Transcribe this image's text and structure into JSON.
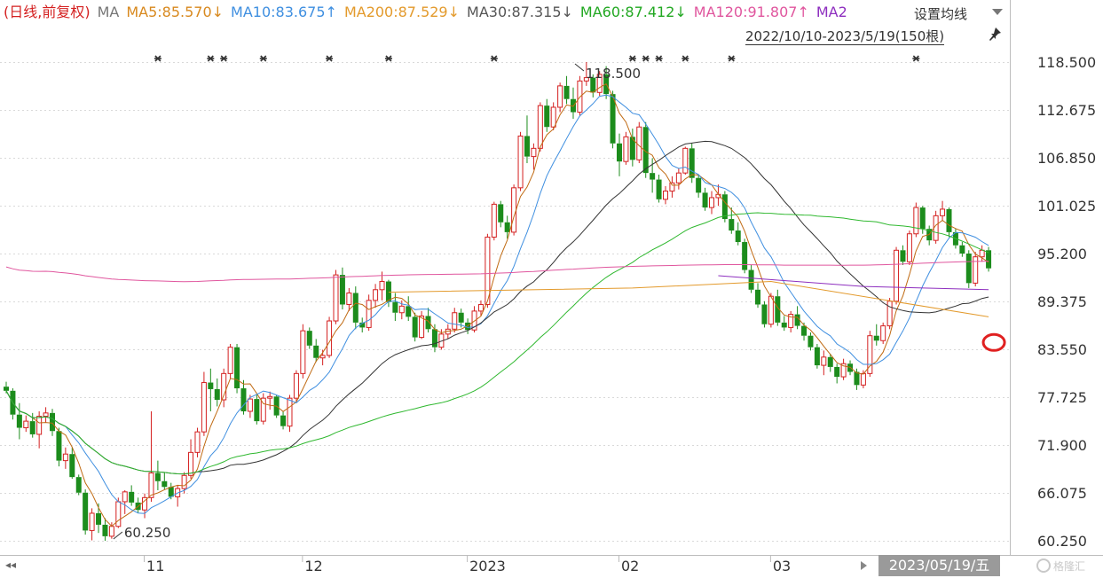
{
  "legend": {
    "period": "(日线,前复权)",
    "ma_label": "MA",
    "ma5": "MA5:85.570↓",
    "ma10": "MA10:83.675↑",
    "ma200": "MA200:87.529↓",
    "ma30": "MA30:87.315↓",
    "ma60": "MA60:87.412↓",
    "ma120": "MA120:91.807↑",
    "ma_more": "MA2"
  },
  "settings_label": "设置均线",
  "date_range": "2022/10/10-2023/5/19(150根)",
  "selected_date": "2023/05/19/五",
  "watermark": "格隆汇",
  "colors": {
    "up": "#d42020",
    "down": "#1c8c1c",
    "ma5": "#c06a12",
    "ma10": "#3f8fe0",
    "ma30": "#333333",
    "ma60": "#2fb82f",
    "ma120": "#e0569e",
    "ma200": "#e39a2c",
    "ma_extra": "#8e2fbf",
    "ma5_text": "#d8891f",
    "ma10_text": "#3f8fe0",
    "ma200_text": "#e39a2c",
    "ma30_text": "#555555",
    "ma60_text": "#22a822",
    "ma120_text": "#e0569e",
    "ma_more_text": "#8e2fbf",
    "highlight": "#e02020"
  },
  "chart_data": {
    "type": "candlestick",
    "y_ticks": [
      "118.500",
      "112.675",
      "106.850",
      "101.025",
      "95.200",
      "89.375",
      "83.550",
      "77.725",
      "71.900",
      "66.075",
      "60.250"
    ],
    "ylim": [
      60.25,
      118.5
    ],
    "x_labels": [
      {
        "label": "11",
        "index": 21
      },
      {
        "label": "12",
        "index": 45
      },
      {
        "label": "2023",
        "index": 70
      },
      {
        "label": "02",
        "index": 93
      },
      {
        "label": "03",
        "index": 116
      },
      {
        "label": "04",
        "index": 139
      }
    ],
    "annotations": [
      {
        "text": "118.500",
        "index": 86,
        "value": 118.5
      },
      {
        "text": "60.250",
        "index": 16,
        "value": 60.25
      }
    ],
    "marker_indices": [
      23,
      31,
      33,
      39,
      49,
      58,
      74,
      95,
      97,
      99,
      103,
      110,
      138,
      167,
      174,
      176,
      178
    ],
    "ohlc": [
      [
        79.0,
        79.6,
        78.2,
        78.5
      ],
      [
        78.5,
        78.8,
        75.0,
        75.6
      ],
      [
        75.6,
        77.0,
        72.6,
        74.0
      ],
      [
        74.0,
        75.5,
        73.5,
        74.8
      ],
      [
        74.8,
        75.8,
        72.8,
        73.2
      ],
      [
        73.2,
        76.0,
        71.5,
        75.4
      ],
      [
        75.4,
        76.5,
        74.6,
        75.8
      ],
      [
        75.8,
        76.3,
        73.0,
        73.6
      ],
      [
        73.6,
        74.0,
        69.3,
        70.0
      ],
      [
        70.0,
        71.6,
        69.0,
        70.8
      ],
      [
        70.8,
        71.6,
        67.8,
        68.0
      ],
      [
        68.0,
        68.3,
        65.8,
        66.1
      ],
      [
        66.1,
        66.5,
        61.0,
        61.5
      ],
      [
        61.5,
        64.2,
        60.3,
        63.6
      ],
      [
        63.6,
        64.8,
        61.2,
        62.2
      ],
      [
        62.2,
        63.0,
        60.25,
        60.8
      ],
      [
        60.8,
        62.5,
        60.5,
        62.0
      ],
      [
        62.0,
        65.5,
        61.8,
        65.0
      ],
      [
        65.0,
        66.4,
        63.5,
        66.2
      ],
      [
        66.2,
        67.0,
        64.5,
        64.9
      ],
      [
        64.9,
        65.5,
        63.6,
        64.0
      ],
      [
        64.0,
        66.0,
        63.0,
        65.5
      ],
      [
        65.5,
        76.0,
        65.0,
        68.5
      ],
      [
        68.5,
        70.0,
        66.4,
        67.5
      ],
      [
        67.5,
        68.5,
        66.5,
        66.8
      ],
      [
        66.8,
        67.3,
        65.3,
        65.6
      ],
      [
        65.6,
        67.0,
        64.4,
        66.6
      ],
      [
        66.6,
        68.6,
        66.0,
        68.2
      ],
      [
        68.2,
        72.6,
        67.8,
        71.0
      ],
      [
        71.0,
        74.0,
        70.4,
        73.5
      ],
      [
        73.5,
        80.8,
        73.0,
        79.5
      ],
      [
        79.5,
        81.2,
        76.0,
        78.7
      ],
      [
        78.7,
        80.0,
        76.6,
        77.4
      ],
      [
        77.4,
        81.2,
        76.5,
        80.6
      ],
      [
        80.6,
        84.2,
        80.0,
        83.8
      ],
      [
        83.8,
        84.2,
        78.2,
        78.8
      ],
      [
        78.8,
        79.8,
        75.6,
        76.0
      ],
      [
        76.0,
        78.0,
        75.2,
        77.5
      ],
      [
        77.5,
        78.0,
        74.4,
        74.8
      ],
      [
        74.8,
        78.2,
        74.4,
        77.6
      ],
      [
        77.6,
        78.4,
        76.2,
        77.8
      ],
      [
        77.8,
        78.0,
        75.2,
        75.5
      ],
      [
        75.5,
        76.0,
        73.8,
        74.2
      ],
      [
        74.2,
        78.0,
        73.5,
        77.6
      ],
      [
        77.6,
        81.0,
        77.0,
        80.6
      ],
      [
        80.6,
        86.6,
        80.0,
        85.8
      ],
      [
        85.8,
        86.2,
        83.6,
        84.0
      ],
      [
        84.0,
        84.8,
        82.0,
        82.5
      ],
      [
        82.5,
        83.5,
        81.6,
        82.8
      ],
      [
        82.8,
        87.5,
        82.5,
        87.0
      ],
      [
        87.0,
        93.2,
        86.6,
        92.6
      ],
      [
        92.6,
        93.5,
        88.4,
        89.0
      ],
      [
        89.0,
        91.0,
        88.2,
        90.4
      ],
      [
        90.4,
        91.2,
        86.0,
        86.8
      ],
      [
        86.8,
        87.4,
        85.6,
        86.2
      ],
      [
        86.2,
        90.2,
        85.8,
        89.5
      ],
      [
        89.5,
        91.5,
        88.6,
        90.8
      ],
      [
        90.8,
        93.0,
        89.5,
        91.8
      ],
      [
        91.8,
        92.0,
        88.7,
        89.3
      ],
      [
        89.3,
        90.4,
        87.0,
        88.0
      ],
      [
        88.0,
        89.5,
        87.2,
        88.8
      ],
      [
        88.8,
        90.0,
        87.0,
        87.5
      ],
      [
        87.5,
        88.0,
        84.5,
        85.0
      ],
      [
        85.0,
        88.2,
        84.8,
        87.6
      ],
      [
        87.6,
        88.6,
        85.6,
        86.0
      ],
      [
        86.0,
        86.6,
        83.2,
        83.8
      ],
      [
        83.8,
        86.0,
        83.5,
        85.4
      ],
      [
        85.4,
        86.6,
        84.8,
        86.0
      ],
      [
        86.0,
        88.6,
        85.6,
        88.0
      ],
      [
        88.0,
        88.5,
        86.2,
        86.8
      ],
      [
        86.8,
        87.3,
        85.4,
        85.9
      ],
      [
        85.9,
        88.8,
        85.6,
        88.2
      ],
      [
        88.2,
        89.5,
        87.6,
        89.0
      ],
      [
        89.0,
        97.6,
        88.6,
        97.2
      ],
      [
        97.2,
        101.5,
        96.8,
        101.2
      ],
      [
        101.2,
        101.6,
        98.4,
        99.0
      ],
      [
        99.0,
        99.8,
        97.0,
        97.8
      ],
      [
        97.8,
        103.6,
        97.4,
        103.2
      ],
      [
        103.2,
        110.0,
        102.8,
        109.5
      ],
      [
        109.5,
        112.0,
        106.2,
        107.0
      ],
      [
        107.0,
        108.6,
        105.4,
        108.0
      ],
      [
        108.0,
        113.6,
        107.6,
        113.2
      ],
      [
        113.2,
        114.0,
        110.0,
        110.6
      ],
      [
        110.6,
        113.6,
        110.2,
        113.0
      ],
      [
        113.0,
        116.0,
        112.4,
        115.6
      ],
      [
        115.6,
        116.8,
        113.4,
        114.0
      ],
      [
        114.0,
        115.4,
        111.6,
        112.4
      ],
      [
        112.4,
        116.8,
        112.0,
        116.2
      ],
      [
        116.2,
        118.5,
        115.6,
        116.6
      ],
      [
        116.6,
        117.0,
        114.2,
        114.8
      ],
      [
        114.8,
        117.4,
        114.4,
        117.0
      ],
      [
        117.0,
        118.0,
        114.0,
        114.6
      ],
      [
        114.6,
        115.0,
        108.0,
        108.6
      ],
      [
        108.6,
        109.8,
        104.6,
        106.4
      ],
      [
        106.4,
        110.0,
        106.0,
        109.4
      ],
      [
        109.4,
        110.4,
        105.8,
        106.6
      ],
      [
        106.6,
        111.2,
        106.2,
        110.6
      ],
      [
        110.6,
        111.2,
        104.4,
        105.0
      ],
      [
        105.0,
        106.8,
        102.6,
        104.2
      ],
      [
        104.2,
        104.8,
        101.4,
        101.8
      ],
      [
        101.8,
        103.4,
        101.2,
        102.8
      ],
      [
        102.8,
        104.6,
        102.0,
        103.8
      ],
      [
        103.8,
        105.6,
        103.0,
        105.0
      ],
      [
        105.0,
        108.2,
        104.8,
        108.0
      ],
      [
        108.0,
        108.6,
        103.8,
        104.4
      ],
      [
        104.4,
        104.8,
        102.0,
        102.6
      ],
      [
        102.6,
        103.2,
        100.4,
        100.8
      ],
      [
        100.8,
        102.8,
        100.0,
        102.0
      ],
      [
        102.0,
        103.6,
        101.0,
        102.4
      ],
      [
        102.4,
        102.8,
        99.0,
        99.4
      ],
      [
        99.4,
        100.8,
        97.6,
        98.0
      ],
      [
        98.0,
        99.0,
        96.2,
        96.6
      ],
      [
        96.6,
        97.0,
        92.8,
        93.2
      ],
      [
        93.2,
        93.8,
        90.4,
        90.8
      ],
      [
        90.8,
        91.6,
        88.6,
        89.0
      ],
      [
        89.0,
        89.4,
        86.2,
        86.6
      ],
      [
        86.6,
        90.4,
        86.2,
        90.0
      ],
      [
        90.0,
        90.8,
        86.4,
        86.8
      ],
      [
        86.8,
        87.6,
        85.8,
        86.2
      ],
      [
        86.2,
        88.2,
        85.6,
        87.8
      ],
      [
        87.8,
        88.8,
        86.0,
        86.4
      ],
      [
        86.4,
        86.8,
        84.6,
        85.2
      ],
      [
        85.2,
        85.6,
        83.4,
        83.8
      ],
      [
        83.8,
        84.2,
        81.2,
        81.6
      ],
      [
        81.6,
        83.4,
        80.4,
        82.6
      ],
      [
        82.6,
        83.0,
        80.8,
        81.4
      ],
      [
        81.4,
        81.8,
        79.4,
        80.2
      ],
      [
        80.2,
        82.4,
        79.8,
        81.8
      ],
      [
        81.8,
        82.2,
        80.4,
        80.8
      ],
      [
        80.8,
        81.2,
        78.6,
        79.2
      ],
      [
        79.2,
        81.0,
        78.8,
        80.6
      ],
      [
        80.6,
        85.8,
        80.2,
        85.2
      ],
      [
        85.2,
        86.6,
        84.0,
        84.6
      ],
      [
        84.6,
        86.8,
        84.2,
        86.4
      ],
      [
        86.4,
        89.8,
        86.0,
        89.4
      ],
      [
        89.4,
        96.0,
        89.0,
        95.6
      ],
      [
        95.6,
        96.2,
        93.8,
        94.2
      ],
      [
        94.2,
        98.0,
        93.8,
        97.6
      ],
      [
        97.6,
        101.4,
        97.2,
        100.8
      ],
      [
        100.8,
        101.0,
        97.6,
        98.2
      ],
      [
        98.2,
        98.6,
        96.2,
        96.8
      ],
      [
        96.8,
        100.4,
        96.4,
        99.8
      ],
      [
        99.8,
        101.6,
        99.2,
        100.6
      ],
      [
        100.6,
        100.8,
        97.2,
        97.8
      ],
      [
        97.8,
        98.2,
        95.8,
        96.2
      ],
      [
        96.2,
        96.6,
        94.8,
        95.2
      ],
      [
        95.2,
        95.6,
        91.0,
        91.6
      ],
      [
        91.6,
        95.4,
        91.2,
        94.8
      ],
      [
        94.8,
        96.2,
        94.2,
        95.6
      ],
      [
        95.6,
        96.0,
        93.0,
        93.4
      ]
    ],
    "last_close": 87.4
  }
}
